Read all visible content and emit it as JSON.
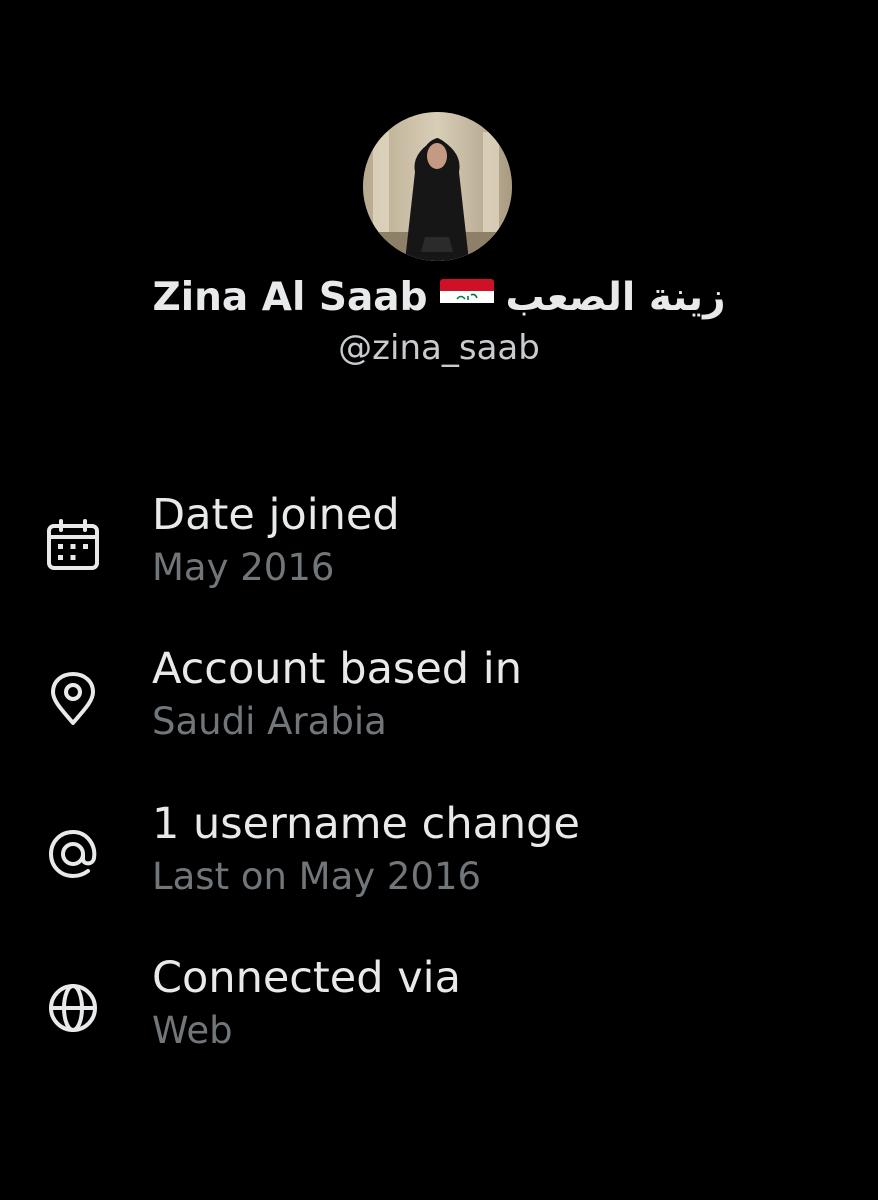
{
  "profile": {
    "display_name": "Zina Al Saab",
    "flag_icon": "iraq-flag-icon",
    "display_name_arabic": "زينة الصعب",
    "handle": "@zina_saab"
  },
  "about": {
    "items": [
      {
        "icon": "calendar-icon",
        "label": "Date joined",
        "value": "May 2016"
      },
      {
        "icon": "location-pin-icon",
        "label": "Account based in",
        "value": "Saudi Arabia"
      },
      {
        "icon": "at-sign-icon",
        "label": "1 username change",
        "value": "Last on May 2016"
      },
      {
        "icon": "globe-icon",
        "label": "Connected via",
        "value": "Web"
      }
    ]
  },
  "colors": {
    "background": "#000000",
    "primary_text": "#e7e9ea",
    "secondary_text": "#71767b",
    "icon": "#e7e9ea"
  }
}
